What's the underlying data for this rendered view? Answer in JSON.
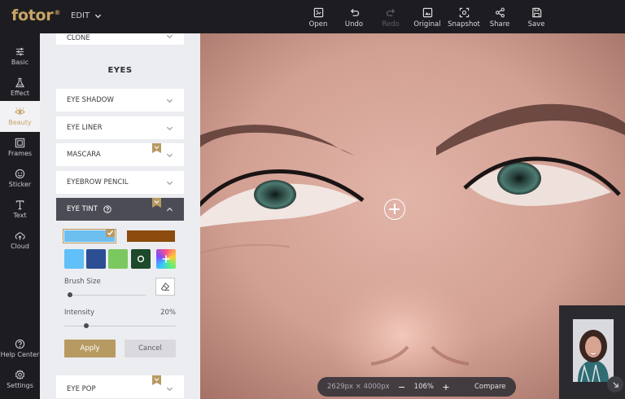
{
  "app": {
    "logo": "fotor",
    "logo_mark": "®",
    "edit_label": "EDIT"
  },
  "toolbar": [
    {
      "label": "Open",
      "icon": "open-icon"
    },
    {
      "label": "Undo",
      "icon": "undo-icon"
    },
    {
      "label": "Redo",
      "icon": "redo-icon",
      "disabled": true
    },
    {
      "label": "Original",
      "icon": "original-icon"
    },
    {
      "label": "Snapshot",
      "icon": "snapshot-icon"
    },
    {
      "label": "Share",
      "icon": "share-icon"
    },
    {
      "label": "Save",
      "icon": "save-icon"
    }
  ],
  "sidebar": {
    "items": [
      {
        "label": "Basic",
        "icon": "sliders-icon"
      },
      {
        "label": "Effect",
        "icon": "flask-icon"
      },
      {
        "label": "Beauty",
        "icon": "eye-icon",
        "active": true
      },
      {
        "label": "Frames",
        "icon": "frame-icon"
      },
      {
        "label": "Sticker",
        "icon": "sticker-icon"
      },
      {
        "label": "Text",
        "icon": "text-icon"
      },
      {
        "label": "Cloud",
        "icon": "cloud-icon"
      }
    ],
    "bottom": [
      {
        "label": "Help Center",
        "icon": "help-icon"
      },
      {
        "label": "Settings",
        "icon": "settings-icon"
      }
    ]
  },
  "panel": {
    "partial_top_item": "CLONE",
    "section_title": "EYES",
    "items": [
      "EYE SHADOW",
      "EYE LINER",
      "MASCARA",
      "EYEBROW PENCIL"
    ],
    "active_item": "EYE TINT",
    "bottom_item": "EYE POP",
    "swatch_colors": {
      "selected_bar": "#6dbff0",
      "second_bar": "#8a4b0c",
      "chips": [
        "#60c0f7",
        "#2c4f94",
        "#7cc860",
        "#1c4a2a"
      ]
    },
    "brush_size_label": "Brush Size",
    "intensity_label": "Intensity",
    "intensity_value": "20%",
    "intensity": 0.2,
    "apply_label": "Apply",
    "cancel_label": "Cancel"
  },
  "canvas": {
    "dimensions": "2629px × 4000px",
    "zoom_out": "−",
    "zoom_value": "106%",
    "zoom_in": "+",
    "compare_label": "Compare"
  },
  "accent": "#c7a366"
}
